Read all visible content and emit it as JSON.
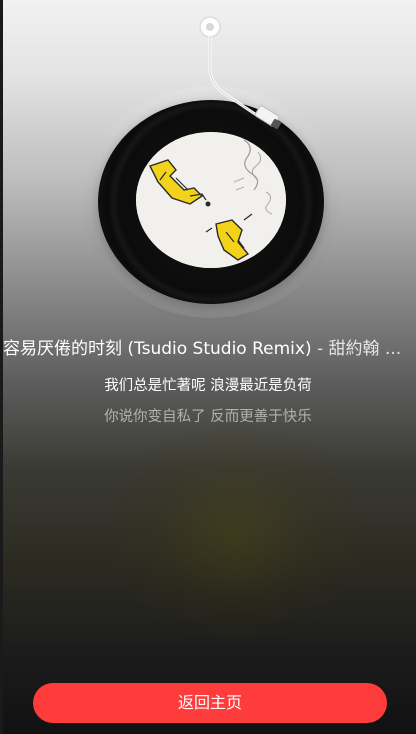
{
  "song": {
    "title": "容易厌倦的时刻 (Tsudio Studio Remix)",
    "separator": " - ",
    "artist": "甜約翰 ..."
  },
  "lyrics": {
    "current": "我们总是忙著呢 浪漫最近是负荷",
    "next": "你说你变自私了 反而更善于快乐"
  },
  "actions": {
    "home_label": "返回主页"
  },
  "colors": {
    "accent": "#ff3c3c",
    "text_primary": "#ffffff"
  },
  "icons": {
    "record": "vinyl-record-icon",
    "tonearm": "tonearm-icon"
  }
}
